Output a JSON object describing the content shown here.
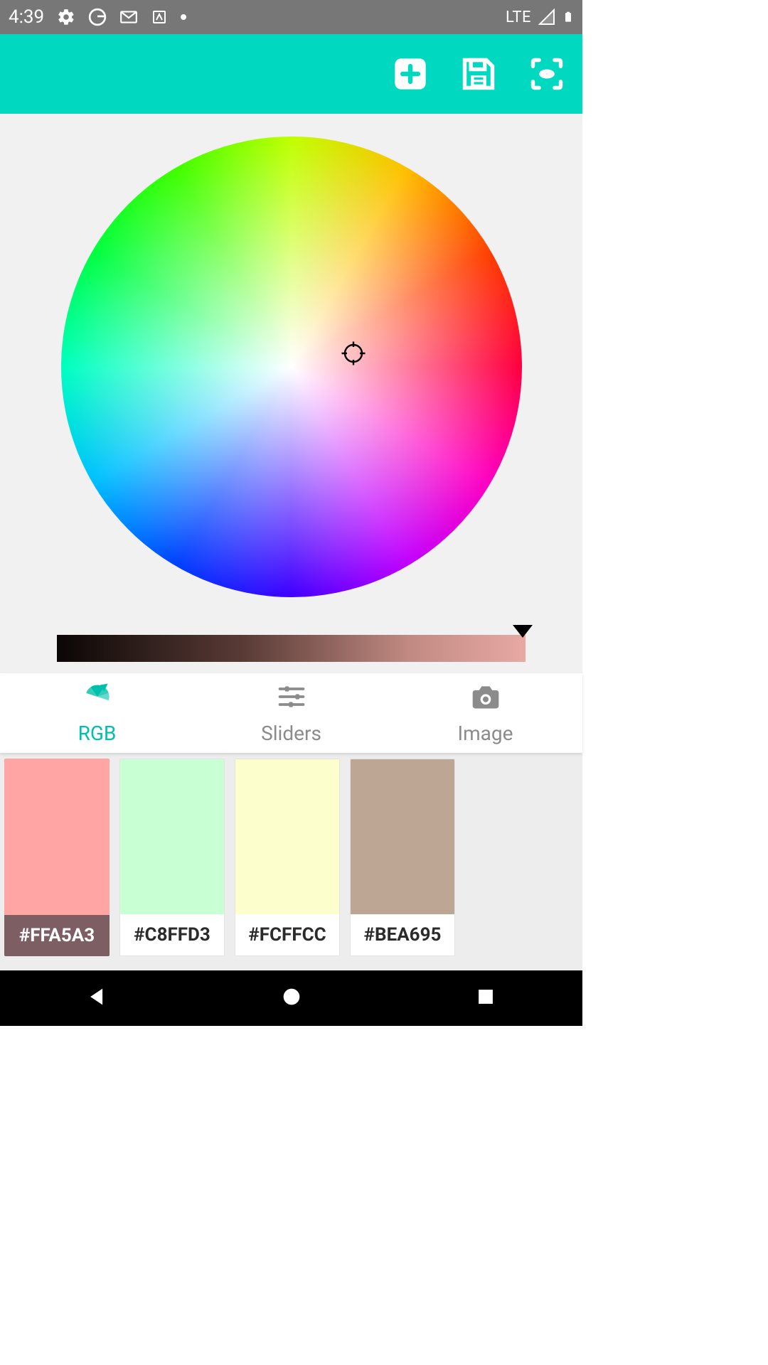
{
  "status": {
    "time": "4:39",
    "network": "LTE"
  },
  "toolbar": {
    "add_icon": "add-icon",
    "save_icon": "save-icon",
    "scan_icon": "scan-icon"
  },
  "picker": {
    "wheel_crosshair_icon": "crosshair-icon"
  },
  "tabs": {
    "items": [
      {
        "label": "RGB",
        "icon": "palette-icon",
        "active": true
      },
      {
        "label": "Sliders",
        "icon": "sliders-icon",
        "active": false
      },
      {
        "label": "Image",
        "icon": "camera-icon",
        "active": false
      }
    ]
  },
  "swatches": [
    {
      "hex": "#FFA5A3",
      "color": "#FFA5A3",
      "selected": true
    },
    {
      "hex": "#C8FFD3",
      "color": "#C8FFD3",
      "selected": false
    },
    {
      "hex": "#FCFFCC",
      "color": "#FCFFCC",
      "selected": false
    },
    {
      "hex": "#BEA695",
      "color": "#BEA695",
      "selected": false
    }
  ],
  "colors": {
    "accent": "#00d9c0",
    "accent_text": "#00c0ab"
  }
}
